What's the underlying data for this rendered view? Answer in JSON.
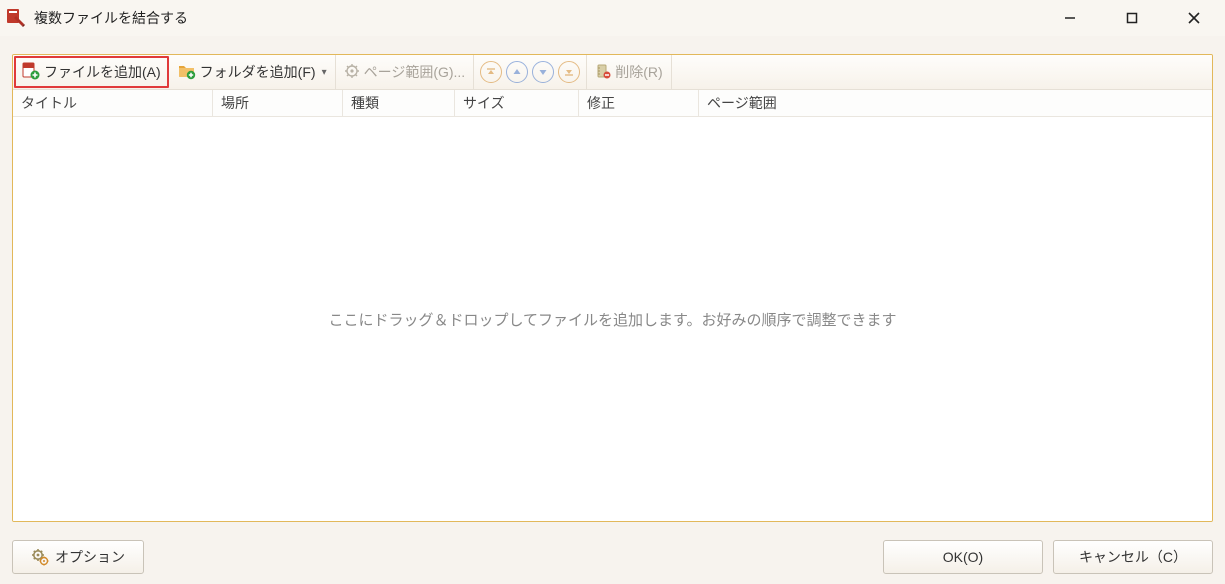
{
  "window": {
    "title": "複数ファイルを結合する"
  },
  "toolbar": {
    "add_file": "ファイルを追加(A)",
    "add_folder": "フォルダを追加(F)",
    "page_range": "ページ範囲(G)...",
    "delete": "削除(R)"
  },
  "columns": {
    "title": "タイトル",
    "location": "場所",
    "type": "種類",
    "size": "サイズ",
    "modified": "修正",
    "range": "ページ範囲"
  },
  "drop_hint": "ここにドラッグ＆ドロップしてファイルを追加します。お好みの順序で調整できます",
  "buttons": {
    "options": "オプション",
    "ok": "OK(O)",
    "cancel": "キャンセル（C）"
  }
}
